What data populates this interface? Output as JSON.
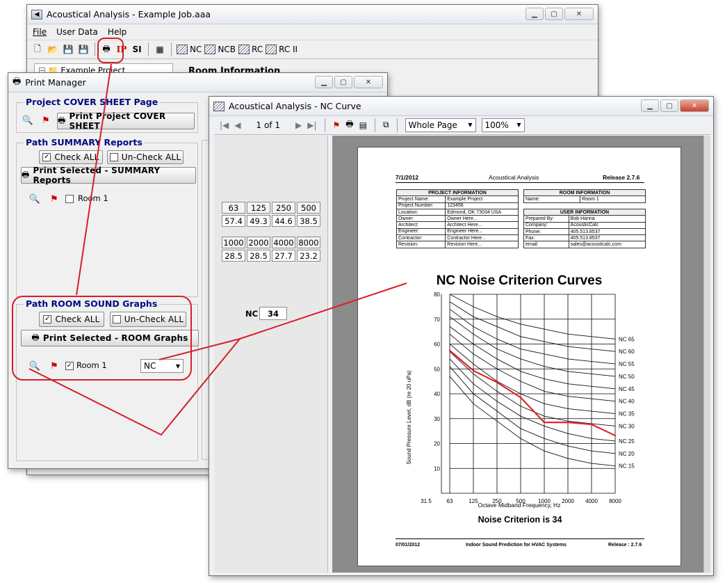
{
  "main_window": {
    "title": "Acoustical Analysis - Example Job.aaa",
    "menu": [
      "File",
      "User Data",
      "Help"
    ],
    "toolbar": {
      "ip": "IP",
      "si": "SI",
      "nc": "NC",
      "ncb": "NCB",
      "rc": "RC",
      "rc2": "RC II"
    },
    "tree_item": "Example Project",
    "panel_title": "Room Information"
  },
  "print_manager": {
    "title": "Print Manager",
    "cover": {
      "group_label": "Project COVER SHEET Page",
      "print_button": "Print Project COVER SHEET"
    },
    "summary": {
      "group_label": "Path SUMMARY Reports",
      "check_all": "Check ALL",
      "uncheck_all": "Un-Check ALL",
      "print_button": "Print Selected - SUMMARY Reports",
      "room_label": "Room 1"
    },
    "room_sound": {
      "group_label": "Path ROOM SOUND Graphs",
      "check_all": "Check ALL",
      "uncheck_all": "Un-Check ALL",
      "print_button": "Print Selected - ROOM Graphs",
      "room_label": "Room 1",
      "curve_select": "NC"
    }
  },
  "nc_window": {
    "title": "Acoustical Analysis - NC Curve",
    "page_indicator": "1 of 1",
    "page_mode": "Whole Page",
    "zoom": "100%",
    "bands": [
      "63",
      "125",
      "250",
      "500",
      "1000",
      "2000",
      "4000",
      "8000"
    ],
    "levels": [
      "57.4",
      "49.3",
      "44.6",
      "38.5",
      "28.5",
      "28.5",
      "27.7",
      "23.2"
    ],
    "nc_label": "NC",
    "nc_value": "34"
  },
  "report": {
    "date": "7/1/2012",
    "header_title": "Acoustical Analysis",
    "release": "Release 2.7.6",
    "project_info": {
      "heading": "PROJECT INFORMATION",
      "rows": [
        [
          "Project Name:",
          "Example Project"
        ],
        [
          "Project Number:",
          "123456"
        ],
        [
          "Location:",
          "Edmond, OK 73034 USA"
        ],
        [
          "Owner:",
          "Owner Here..."
        ],
        [
          "Architect:",
          "Architect Here..."
        ],
        [
          "Engineer:",
          "Engineer Here..."
        ],
        [
          "Contractor:",
          "Contractor Here..."
        ],
        [
          "Revision:",
          "Revision Here..."
        ]
      ]
    },
    "room_info": {
      "heading": "ROOM INFORMATION",
      "rows": [
        [
          "Name:",
          "Room 1"
        ]
      ]
    },
    "user_info": {
      "heading": "USER INFORMATION",
      "rows": [
        [
          "Prepared By:",
          "Bob Hanna"
        ],
        [
          "Company:",
          "AcousticCalc"
        ],
        [
          "Phone:",
          "405.513.8537"
        ],
        [
          "Fax:",
          "405.513.8537"
        ],
        [
          "email:",
          "sales@acousticalc.com"
        ]
      ]
    },
    "result": "Noise Criterion is 34",
    "footer_date": "07/01/2012",
    "footer_title": "Indoor Sound Prediction for HVAC Systems",
    "footer_release": "Release : 2.7.6"
  },
  "chart_data": {
    "type": "line",
    "title": "NC Noise Criterion Curves",
    "xlabel": "Octave Midband Frequency, Hz",
    "ylabel": "Sound Pressure Level, dB (re 20 uPa)",
    "categories": [
      "31.5",
      "63",
      "125",
      "250",
      "500",
      "1000",
      "2000",
      "4000",
      "8000"
    ],
    "yticks": [
      "10",
      "20",
      "30",
      "40",
      "50",
      "60",
      "70",
      "80"
    ],
    "ylim": [
      0,
      80
    ],
    "grid": true,
    "curves": [
      {
        "name": "NC 65",
        "values": [
          80,
          75,
          71,
          68,
          66,
          64,
          63,
          62
        ]
      },
      {
        "name": "NC 60",
        "values": [
          77,
          71,
          67,
          63,
          61,
          59,
          58,
          57
        ]
      },
      {
        "name": "NC 55",
        "values": [
          74,
          67,
          62,
          58,
          56,
          54,
          53,
          52
        ]
      },
      {
        "name": "NC 50",
        "values": [
          71,
          64,
          58,
          54,
          51,
          49,
          48,
          47
        ]
      },
      {
        "name": "NC 45",
        "values": [
          67,
          60,
          54,
          49,
          46,
          44,
          43,
          42
        ]
      },
      {
        "name": "NC 40",
        "values": [
          64,
          56,
          50,
          45,
          41,
          39,
          38,
          37
        ]
      },
      {
        "name": "NC 35",
        "values": [
          60,
          52,
          45,
          40,
          36,
          34,
          33,
          32
        ]
      },
      {
        "name": "NC 30",
        "values": [
          57,
          48,
          41,
          35,
          31,
          29,
          28,
          27
        ]
      },
      {
        "name": "NC 25",
        "values": [
          54,
          44,
          37,
          31,
          27,
          24,
          22,
          21
        ]
      },
      {
        "name": "NC 20",
        "values": [
          51,
          40,
          33,
          26,
          22,
          19,
          17,
          16
        ]
      },
      {
        "name": "NC 15",
        "values": [
          47,
          36,
          29,
          22,
          17,
          14,
          12,
          11
        ]
      }
    ],
    "series": [
      {
        "values": [
          57.4,
          49.3,
          44.6,
          38.5,
          28.5,
          28.5,
          27.7,
          23.2
        ],
        "color": "#e0262d"
      }
    ]
  }
}
